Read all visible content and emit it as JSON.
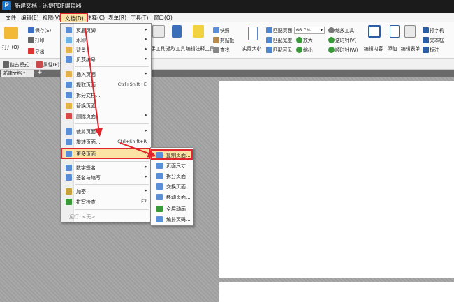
{
  "window": {
    "title": "新建文档 - 迅捷PDF编辑器",
    "app_icon_letter": "P"
  },
  "menubar": {
    "items": [
      "文件",
      "编辑(E)",
      "视图(V)",
      "文档(D)",
      "注释(C)",
      "表单(R)",
      "工具(T)",
      "窗口(O)"
    ]
  },
  "ribbon": {
    "open": "打开(O)",
    "save": "保存(S)",
    "print": "打印",
    "export": "导出",
    "standalone": "独占模式",
    "properties": "属性(P)",
    "hand_tool": "手工具",
    "select_tool": "选取工具",
    "edit_annot_tool": "编辑注释工具",
    "snapshot": "快照",
    "clipboard": "剪贴板",
    "find": "查找",
    "actual_size": "实际大小",
    "fit_page": "匹配页面",
    "fit_width": "匹配宽度",
    "fit_visible": "匹配可见",
    "zoom_value": "66.7%",
    "zoom_tool": "缩放工具",
    "zoom_in": "放大",
    "zoom_out": "缩小",
    "rotate_ccw": "逆时针(V)",
    "rotate_cw": "顺时针(W)",
    "edit_content": "编辑内容",
    "add": "添加",
    "edit_form": "编辑表单",
    "typewriter": "打字机",
    "textbox": "文本框",
    "annotation": "标注"
  },
  "tab": {
    "label": "新建文档 *",
    "add": "+"
  },
  "docs_menu": {
    "items": [
      {
        "label": "页眉页脚",
        "shortcut": "",
        "arrow": "▸"
      },
      {
        "label": "水印",
        "shortcut": "",
        "arrow": "▸"
      },
      {
        "label": "背景",
        "shortcut": "",
        "arrow": "▸"
      },
      {
        "label": "贝茨编号",
        "shortcut": "",
        "arrow": "▸"
      },
      {
        "label": "插入页面",
        "shortcut": "",
        "arrow": "▸"
      },
      {
        "label": "提取页面...",
        "shortcut": "Ctrl+Shift+E",
        "arrow": ""
      },
      {
        "label": "拆分文档...",
        "shortcut": "",
        "arrow": ""
      },
      {
        "label": "替换页面...",
        "shortcut": "",
        "arrow": ""
      },
      {
        "label": "删除页面",
        "shortcut": "",
        "arrow": "▸"
      },
      {
        "label": "裁剪页面",
        "shortcut": "",
        "arrow": "▸"
      },
      {
        "label": "旋转页面...",
        "shortcut": "Ctrl+Shift+R",
        "arrow": ""
      },
      {
        "label": "更多页面",
        "shortcut": "",
        "arrow": "▸"
      },
      {
        "label": "数字签名",
        "shortcut": "",
        "arrow": "▸"
      },
      {
        "label": "签名与缩写",
        "shortcut": "",
        "arrow": "▸"
      },
      {
        "label": "加密",
        "shortcut": "",
        "arrow": "▸"
      },
      {
        "label": "拼写检查",
        "shortcut": "F7",
        "arrow": ""
      }
    ],
    "run_label": "运行:  <无>"
  },
  "more_pages_submenu": {
    "items": [
      "复制页面...",
      "页面尺寸...",
      "拆分页面",
      "交换页面",
      "移动页面...",
      "全屏动画",
      "编排页码..."
    ]
  },
  "colors": {
    "highlight": "#fbe3a5",
    "red_annotation": "#e0262c",
    "app_blue": "#1a73c8"
  }
}
